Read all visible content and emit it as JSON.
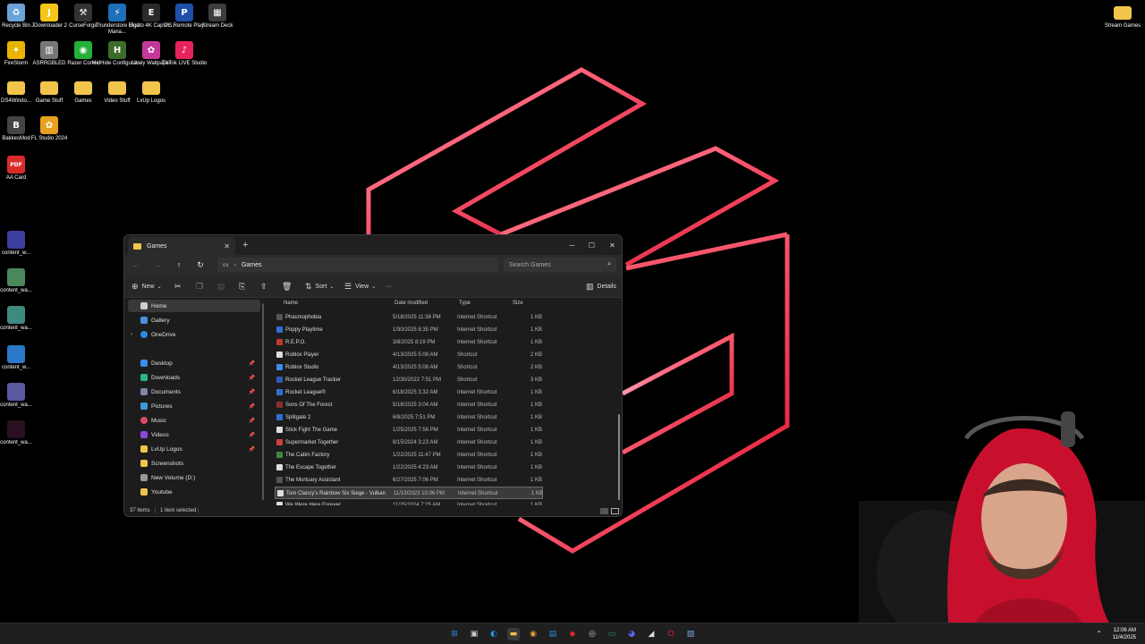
{
  "desktop": {
    "icons": [
      {
        "label": "Recycle Bin",
        "icon": "recycle-bin-icon",
        "color": "#6aa3d6",
        "glyph": "♻"
      },
      {
        "label": "JDownloader 2",
        "icon": "jdownloader-icon",
        "color": "#f5c518",
        "glyph": "J"
      },
      {
        "label": "CurseForge",
        "icon": "curseforge-icon",
        "color": "#333333",
        "glyph": "⚒"
      },
      {
        "label": "Thunderstore Mod Mana...",
        "icon": "thunderstore-icon",
        "color": "#1d6fb8",
        "glyph": "⚡"
      },
      {
        "label": "Elgato 4K Captur...",
        "icon": "elgato-icon",
        "color": "#2a2a2a",
        "glyph": "E"
      },
      {
        "label": "PS Remote Play",
        "icon": "ps-remote-play-icon",
        "color": "#1f4fa8",
        "glyph": "P"
      },
      {
        "label": "Stream Deck",
        "icon": "stream-deck-icon",
        "color": "#3c3c3c",
        "glyph": "▦"
      },
      {
        "label": "FireStorm",
        "icon": "firestorm-icon",
        "color": "#e8b400",
        "glyph": "✦"
      },
      {
        "label": "ASRRGBLED",
        "icon": "asrrgbled-icon",
        "color": "#777777",
        "glyph": "▥"
      },
      {
        "label": "Razer Cortex",
        "icon": "razer-cortex-icon",
        "color": "#25b03a",
        "glyph": "◉"
      },
      {
        "label": "HidHide Configurat...",
        "icon": "hidhide-icon",
        "color": "#3d6b2c",
        "glyph": "H"
      },
      {
        "label": "Lively Wallpaper",
        "icon": "lively-wallpaper-icon",
        "color": "#c2399a",
        "glyph": "✿"
      },
      {
        "label": "TikTok LIVE Studio",
        "icon": "tiktok-live-icon",
        "color": "#e6245b",
        "glyph": "♪"
      },
      {
        "label": "DS4Windo...",
        "icon": "folder-icon",
        "color": "#f1c44b",
        "glyph": ""
      },
      {
        "label": "Game Stuff",
        "icon": "folder-icon",
        "color": "#f1c44b",
        "glyph": ""
      },
      {
        "label": "Games",
        "icon": "folder-icon",
        "color": "#f1c44b",
        "glyph": ""
      },
      {
        "label": "Video Stuff",
        "icon": "folder-icon",
        "color": "#f1c44b",
        "glyph": ""
      },
      {
        "label": "LvUp Logos",
        "icon": "folder-icon",
        "color": "#f1c44b",
        "glyph": ""
      },
      {
        "label": "BakkesMod",
        "icon": "bakkesmod-icon",
        "color": "#444444",
        "glyph": "B"
      },
      {
        "label": "FL Studio 2024",
        "icon": "fl-studio-icon",
        "color": "#e8a020",
        "glyph": "✿"
      },
      {
        "label": "AA Card",
        "icon": "pdf-icon",
        "color": "#d92b2b",
        "glyph": "PDF"
      },
      {
        "label": "content_w...",
        "icon": "image-file-icon",
        "color": "#3b3fa0",
        "glyph": ""
      },
      {
        "label": "content_wa...",
        "icon": "image-file-icon",
        "color": "#4a8a5a",
        "glyph": ""
      },
      {
        "label": "content_wa...",
        "icon": "image-file-icon",
        "color": "#3d8a80",
        "glyph": ""
      },
      {
        "label": "content_w...",
        "icon": "image-file-icon",
        "color": "#2a7ac8",
        "glyph": ""
      },
      {
        "label": "content_wa...",
        "icon": "image-file-icon",
        "color": "#5a5aa0",
        "glyph": ""
      },
      {
        "label": "content_wa...",
        "icon": "image-file-icon",
        "color": "#2a1020",
        "glyph": ""
      },
      {
        "label": "Stream Games",
        "icon": "folder-icon",
        "color": "#f1c44b",
        "glyph": ""
      }
    ]
  },
  "explorer": {
    "tab_title": "Games",
    "new_tab": "+",
    "address": {
      "path": "Games"
    },
    "search": {
      "placeholder": "Search Games"
    },
    "toolbar": {
      "new": "New",
      "sort": "Sort",
      "view": "View",
      "more": "···",
      "details": "Details"
    },
    "nav": {
      "home": "Home",
      "gallery": "Gallery",
      "onedrive": "OneDrive",
      "desktop": "Desktop",
      "downloads": "Downloads",
      "documents": "Documents",
      "pictures": "Pictures",
      "music": "Music",
      "videos": "Videos",
      "lvup_logos": "LvUp Logos",
      "screenshots": "Screenshots",
      "new_volume": "New Volume (D:)",
      "youtube": "Youtube"
    },
    "columns": {
      "name": "Name",
      "date": "Date modified",
      "type": "Type",
      "size": "Size"
    },
    "files": [
      {
        "name": "Phasmophobia",
        "date": "5/18/2025 11:38 PM",
        "type": "Internet Shortcut",
        "size": "1 KB",
        "color": "#555555"
      },
      {
        "name": "Poppy Playtime",
        "date": "1/30/2025 8:35 PM",
        "type": "Internet Shortcut",
        "size": "1 KB",
        "color": "#2f6fd6"
      },
      {
        "name": "R.E.P.O.",
        "date": "3/8/2025 8:19 PM",
        "type": "Internet Shortcut",
        "size": "1 KB",
        "color": "#c0392b"
      },
      {
        "name": "Roblox Player",
        "date": "4/13/2025 5:08 AM",
        "type": "Shortcut",
        "size": "2 KB",
        "color": "#dddddd"
      },
      {
        "name": "Roblox Studio",
        "date": "4/13/2025 5:08 AM",
        "type": "Shortcut",
        "size": "2 KB",
        "color": "#3a8ef0"
      },
      {
        "name": "Rocket League Tracker",
        "date": "12/30/2022 7:51 PM",
        "type": "Shortcut",
        "size": "3 KB",
        "color": "#2b5db8"
      },
      {
        "name": "Rocket League®",
        "date": "6/18/2025 3:32 AM",
        "type": "Internet Shortcut",
        "size": "1 KB",
        "color": "#2f6fd6"
      },
      {
        "name": "Sons Of The Forest",
        "date": "5/18/2025 3:04 AM",
        "type": "Internet Shortcut",
        "size": "1 KB",
        "color": "#8a2f2f"
      },
      {
        "name": "Splitgate 2",
        "date": "6/8/2025 7:51 PM",
        "type": "Internet Shortcut",
        "size": "1 KB",
        "color": "#2f6fd6"
      },
      {
        "name": "Stick Fight The Game",
        "date": "1/25/2025 7:56 PM",
        "type": "Internet Shortcut",
        "size": "1 KB",
        "color": "#dddddd"
      },
      {
        "name": "Supermarket Together",
        "date": "8/15/2024 3:23 AM",
        "type": "Internet Shortcut",
        "size": "1 KB",
        "color": "#d04040"
      },
      {
        "name": "The Cabin Factory",
        "date": "1/22/2025 11:47 PM",
        "type": "Internet Shortcut",
        "size": "1 KB",
        "color": "#3a8a3a"
      },
      {
        "name": "The Escape Together",
        "date": "1/22/2025 4:23 AM",
        "type": "Internet Shortcut",
        "size": "1 KB",
        "color": "#dddddd"
      },
      {
        "name": "The Mortuary Assistant",
        "date": "6/27/2025 7:06 PM",
        "type": "Internet Shortcut",
        "size": "1 KB",
        "color": "#555555"
      },
      {
        "name": "Tom Clancy's Rainbow Six Siege - Vulkan",
        "date": "11/13/2023 10:36 PM",
        "type": "Internet Shortcut",
        "size": "1 KB",
        "color": "#dddddd",
        "selected": true
      },
      {
        "name": "We Were Here Forever",
        "date": "11/25/2024 7:25 AM",
        "type": "Internet Shortcut",
        "size": "1 KB",
        "color": "#dddddd"
      }
    ],
    "status": {
      "count": "37 items",
      "selected": "1 item selected"
    }
  },
  "taskbar": {
    "apps": [
      {
        "icon": "windows-start-icon",
        "glyph": "⊞",
        "color": "#2a8ae8"
      },
      {
        "icon": "task-view-icon",
        "glyph": "▣",
        "color": "#cccccc"
      },
      {
        "icon": "edge-icon",
        "glyph": "◐",
        "color": "#1e9ad6"
      },
      {
        "icon": "file-explorer-icon",
        "glyph": "▬",
        "color": "#f1c44b"
      },
      {
        "icon": "chrome-icon",
        "glyph": "◉",
        "color": "#e9a23b"
      },
      {
        "icon": "store-icon",
        "glyph": "▤",
        "color": "#2a8ae8"
      },
      {
        "icon": "app-icon",
        "glyph": "◆",
        "color": "#d92b2b"
      },
      {
        "icon": "obs-icon",
        "glyph": "◎",
        "color": "#cccccc"
      },
      {
        "icon": "app-icon",
        "glyph": "▭",
        "color": "#1aa05a"
      },
      {
        "icon": "discord-icon",
        "glyph": "◕",
        "color": "#5865f2"
      },
      {
        "icon": "app-icon",
        "glyph": "◢",
        "color": "#dddddd"
      },
      {
        "icon": "opera-gx-icon",
        "glyph": "O",
        "color": "#e0203c"
      },
      {
        "icon": "app-icon",
        "glyph": "▧",
        "color": "#7aa7d6"
      }
    ],
    "time": "12:06 AM",
    "date": "11/4/2025"
  }
}
